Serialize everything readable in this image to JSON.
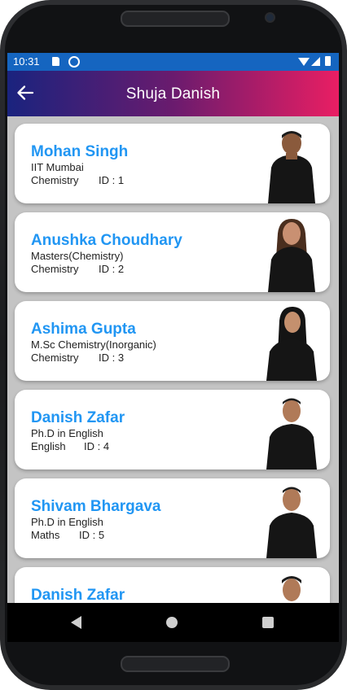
{
  "status_bar": {
    "time": "10:31"
  },
  "app_bar": {
    "title": "Shuja Danish",
    "back_icon": "arrow-left-icon"
  },
  "teachers": [
    {
      "name": "Mohan Singh",
      "qualification": "IIT Mumbai",
      "subject": "Chemistry",
      "id": "ID : 1"
    },
    {
      "name": "Anushka Choudhary",
      "qualification": "Masters(Chemistry)",
      "subject": "Chemistry",
      "id": "ID : 2"
    },
    {
      "name": "Ashima Gupta",
      "qualification": "M.Sc Chemistry(Inorganic)",
      "subject": "Chemistry",
      "id": "ID : 3"
    },
    {
      "name": "Danish Zafar",
      "qualification": "Ph.D in English",
      "subject": "English",
      "id": "ID : 4"
    },
    {
      "name": "Shivam Bhargava",
      "qualification": "Ph.D in English",
      "subject": "Maths",
      "id": "ID : 5"
    },
    {
      "name": "Danish Zafar",
      "qualification": "",
      "subject": "",
      "id": ""
    }
  ],
  "colors": {
    "appbar_start": "#1a237e",
    "appbar_end": "#e91e63",
    "name_color": "#2196f3",
    "status_bar": "#1565c0"
  }
}
